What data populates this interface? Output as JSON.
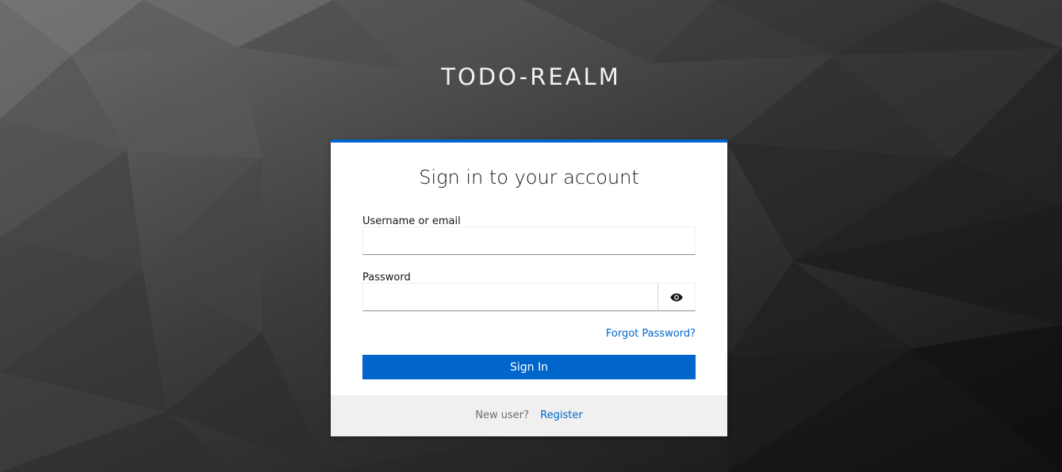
{
  "realm": {
    "title": "TODO-REALM"
  },
  "login": {
    "heading": "Sign in to your account",
    "username_label": "Username or email",
    "username_value": "",
    "password_label": "Password",
    "password_value": "",
    "show_password_icon": "eye-icon",
    "forgot_password": "Forgot Password?",
    "sign_in_label": "Sign In"
  },
  "footer": {
    "new_user_text": "New user?",
    "register_label": "Register"
  },
  "colors": {
    "accent": "#0066cc",
    "background": "#2b2b2b",
    "footer_bg": "#f0f0f0"
  }
}
